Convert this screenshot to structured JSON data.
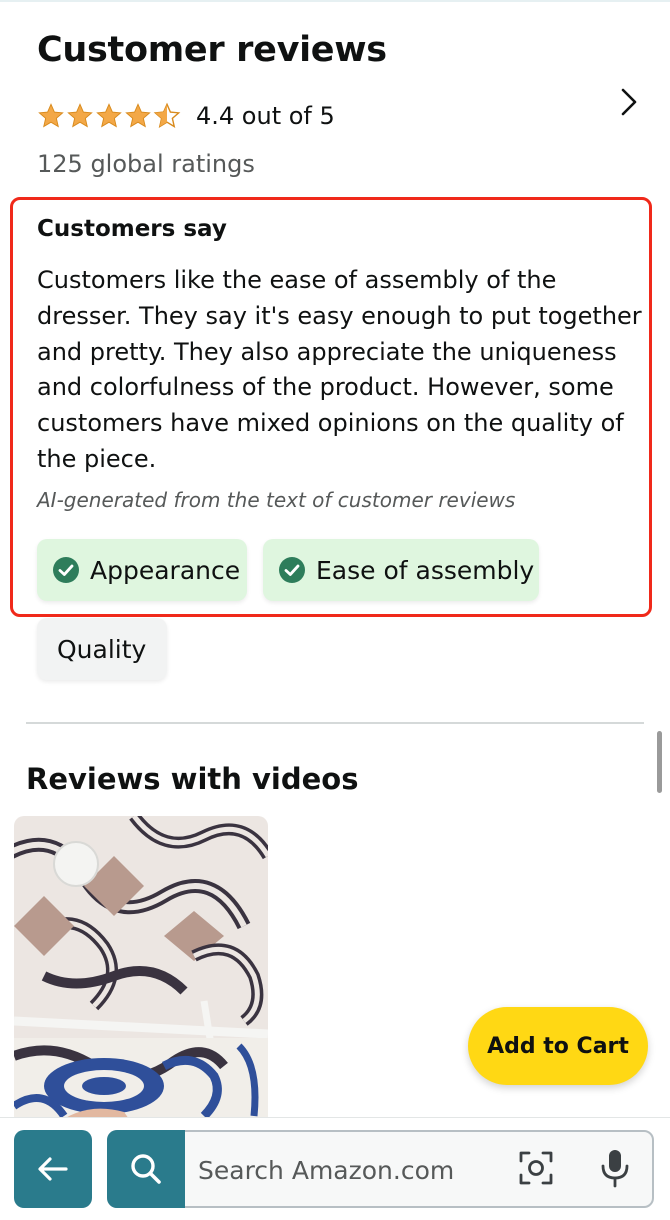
{
  "reviews": {
    "title": "Customer reviews",
    "rating_value": 4.4,
    "rating_text": "4.4 out of 5",
    "global_ratings": "125 global ratings"
  },
  "customers_say": {
    "title": "Customers say",
    "body": "Customers like the ease of assembly of the dresser. They say it's easy enough to put together and pretty. They also appreciate the uniqueness and colorfulness of the product. However, some customers have mixed opinions on the quality of the piece.",
    "note": "AI-generated from the text of customer reviews",
    "chips": [
      {
        "label": "Appearance",
        "sentiment": "positive"
      },
      {
        "label": "Ease of assembly",
        "sentiment": "positive"
      },
      {
        "label": "Quality",
        "sentiment": "mixed"
      }
    ]
  },
  "videos": {
    "title": "Reviews with videos"
  },
  "cart": {
    "label": "Add to Cart"
  },
  "search": {
    "placeholder": "Search Amazon.com"
  },
  "colors": {
    "star": "#f3a847",
    "highlight_border": "#f0291a",
    "chip_positive": "#dff6df",
    "check": "#2e7d5b",
    "add_to_cart": "#ffd814",
    "nav_teal": "#2a7b8c"
  },
  "icons": {
    "chevron": "chevron-right-icon",
    "check": "check-circle-icon",
    "back": "arrow-left-icon",
    "search": "search-icon",
    "camera": "camera-scan-icon",
    "mic": "microphone-icon"
  }
}
